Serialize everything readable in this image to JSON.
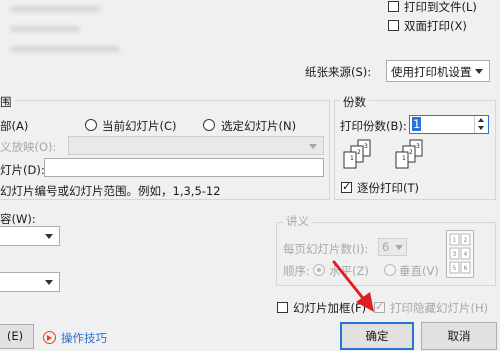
{
  "top_options": {
    "print_to_file": "打印到文件(L)",
    "duplex": "双面打印(X)"
  },
  "paper_source": {
    "label": "纸张来源(S):",
    "value": "使用打印机设置"
  },
  "range": {
    "title": "围",
    "all_partial": "部(A)",
    "current_slide": "当前幻灯片(C)",
    "selected_slides": "选定幻灯片(N)",
    "custom_show_label": "义放映(O):",
    "slides_label": "灯片(D):",
    "hint": "幻灯片编号或幻灯片范围。例如，1,3,5-12"
  },
  "copies": {
    "title": "份数",
    "count_label": "打印份数(B):",
    "count_value": "1",
    "page_labels": [
      "1",
      "2",
      "3"
    ],
    "collate": "逐份打印(T)"
  },
  "left_lower": {
    "what_label": "容(W):"
  },
  "handouts": {
    "title": "讲义",
    "per_page_label": "每页幻灯片数(I):",
    "per_page_value": "6",
    "order_label": "顺序:",
    "horizontal": "水平(Z)",
    "vertical": "垂直(V)",
    "preview_numbers": [
      "1",
      "2",
      "3",
      "4",
      "5",
      "6"
    ]
  },
  "frame_slides": "幻灯片加框(F)",
  "print_hidden": "打印隐藏幻灯片(H)",
  "buttons": {
    "left_partial": "(E)",
    "tips": "操作技巧",
    "ok": "确定",
    "cancel": "取消"
  },
  "colors": {
    "link": "#2b6fd6",
    "tips_icon": "#e0452b",
    "annotation_arrow": "#e02020",
    "focus": "#2a73d6"
  }
}
